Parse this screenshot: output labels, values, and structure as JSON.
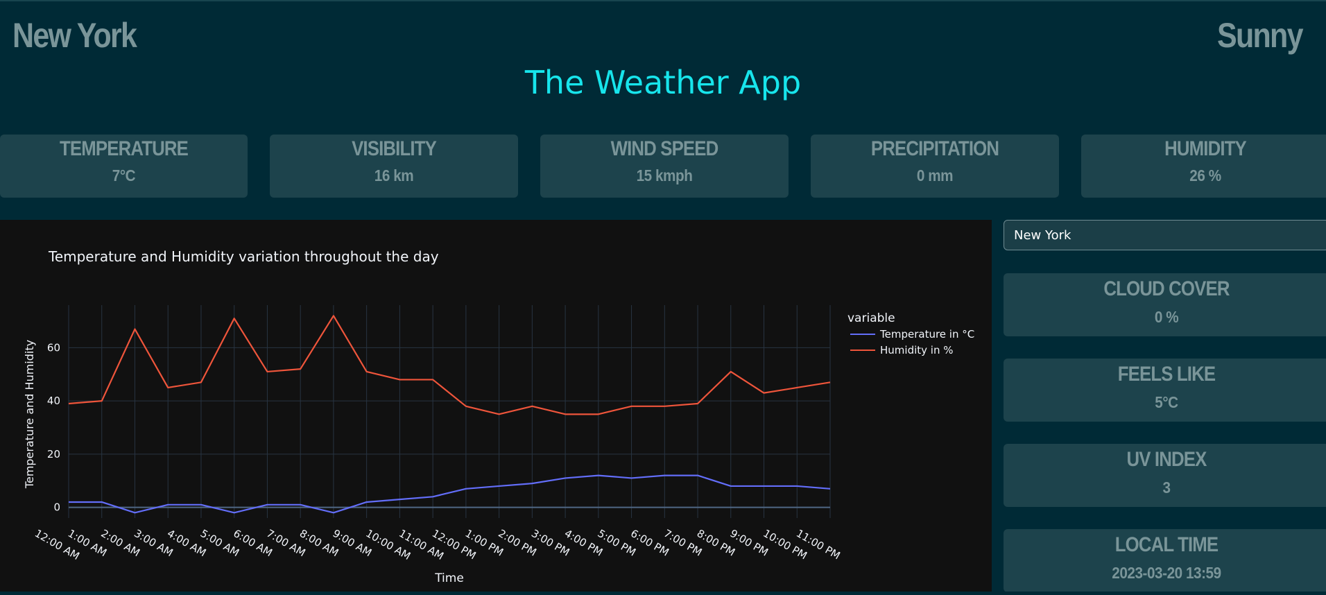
{
  "header": {
    "city": "New York",
    "condition": "Sunny",
    "app_title": "The Weather App"
  },
  "stats": [
    {
      "label": "TEMPERATURE",
      "value": "7°C"
    },
    {
      "label": "VISIBILITY",
      "value": "16 km"
    },
    {
      "label": "WIND SPEED",
      "value": "15 kmph"
    },
    {
      "label": "PRECIPITATION",
      "value": "0 mm"
    },
    {
      "label": "HUMIDITY",
      "value": "26 %"
    }
  ],
  "search": {
    "value": "New York"
  },
  "side_stats": [
    {
      "label": "CLOUD COVER",
      "value": "0 %"
    },
    {
      "label": "FEELS LIKE",
      "value": "5°C"
    },
    {
      "label": "UV INDEX",
      "value": "3"
    },
    {
      "label": "LOCAL TIME",
      "value": "2023-03-20 13:59"
    }
  ],
  "colors": {
    "background": "#002a36",
    "card": "#1d434c",
    "accent": "#17e5ec",
    "temperature_line": "#636efa",
    "humidity_line": "#ef553b"
  },
  "chart_data": {
    "type": "line",
    "title": "Temperature and Humidity variation throughout the day",
    "xlabel": "Time",
    "ylabel": "Temperature and Humidity",
    "legend_title": "variable",
    "legend_position": "top-right",
    "grid": true,
    "categories": [
      "12:00 AM",
      "1:00 AM",
      "2:00 AM",
      "3:00 AM",
      "4:00 AM",
      "5:00 AM",
      "6:00 AM",
      "7:00 AM",
      "8:00 AM",
      "9:00 AM",
      "10:00 AM",
      "11:00 AM",
      "12:00 PM",
      "1:00 PM",
      "2:00 PM",
      "3:00 PM",
      "4:00 PM",
      "5:00 PM",
      "6:00 PM",
      "7:00 PM",
      "8:00 PM",
      "9:00 PM",
      "10:00 PM",
      "11:00 PM"
    ],
    "yticks": [
      0,
      20,
      40,
      60
    ],
    "ylim": [
      -4,
      76
    ],
    "series": [
      {
        "name": "Temperature in °C",
        "values": [
          2,
          2,
          -2,
          1,
          1,
          -2,
          1,
          1,
          -2,
          2,
          3,
          4,
          7,
          8,
          9,
          11,
          12,
          11,
          12,
          12,
          8,
          8,
          8,
          7
        ]
      },
      {
        "name": "Humidity in %",
        "values": [
          39,
          40,
          67,
          45,
          47,
          71,
          51,
          52,
          72,
          51,
          48,
          48,
          38,
          35,
          38,
          35,
          35,
          38,
          38,
          39,
          51,
          43,
          45,
          47
        ]
      }
    ]
  }
}
